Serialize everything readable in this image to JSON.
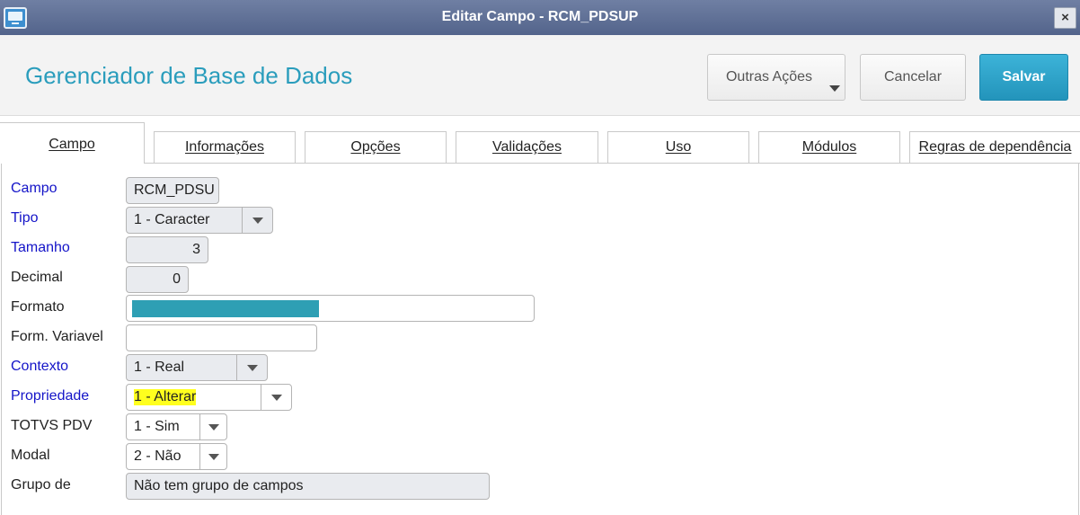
{
  "window": {
    "title": "Editar Campo - RCM_PDSUP",
    "close_label": "×",
    "icon": "app-window-icon"
  },
  "header": {
    "page_title": "Gerenciador de Base de Dados",
    "buttons": {
      "outras": "Outras Ações",
      "cancelar": "Cancelar",
      "salvar": "Salvar"
    }
  },
  "tabs": [
    {
      "label": "Campo",
      "active": true
    },
    {
      "label": "Informações"
    },
    {
      "label": "Opções"
    },
    {
      "label": "Validações"
    },
    {
      "label": "Uso"
    },
    {
      "label": "Módulos"
    },
    {
      "label": "Regras de dependência"
    }
  ],
  "form": {
    "campo": {
      "label": "Campo",
      "value": "RCM_PDSU"
    },
    "tipo": {
      "label": "Tipo",
      "value": "1 - Caracter"
    },
    "tamanho": {
      "label": "Tamanho",
      "value": "3"
    },
    "decimal": {
      "label": "Decimal",
      "value": "0"
    },
    "formato": {
      "label": "Formato",
      "value": ""
    },
    "form_variavel": {
      "label": "Form. Variavel",
      "value": ""
    },
    "contexto": {
      "label": "Contexto",
      "value": "1 - Real"
    },
    "propriedade": {
      "label": "Propriedade",
      "value": "1 - Alterar"
    },
    "totvs_pdv": {
      "label": "TOTVS PDV",
      "value": "1 - Sim"
    },
    "modal": {
      "label": "Modal",
      "value": "2 - Não"
    },
    "grupo": {
      "label": "Grupo de",
      "value": "Não tem grupo de campos"
    }
  },
  "colors": {
    "accent": "#2a9dbc",
    "primary_button": "#2394bb",
    "required_label": "#1414c8",
    "highlight": "#ffff1e"
  }
}
